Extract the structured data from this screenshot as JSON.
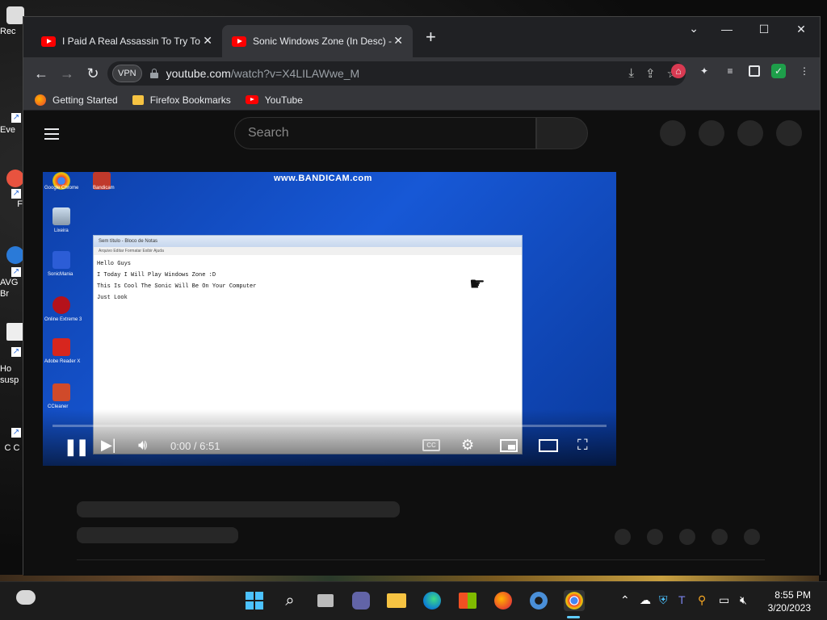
{
  "desktop": {
    "icons": [
      {
        "label": "Rec"
      },
      {
        "label": "Eve"
      },
      {
        "label": "F"
      },
      {
        "label": "AVG Br"
      },
      {
        "label": "Ho susp"
      },
      {
        "label": "C C"
      }
    ]
  },
  "browser": {
    "tabs": [
      {
        "title": "I Paid A Real Assassin To Try To Ki",
        "active": false,
        "icon": "youtube-icon"
      },
      {
        "title": "Sonic Windows Zone (In Desc) - Y",
        "active": true,
        "icon": "youtube-icon"
      }
    ],
    "new_tab_label": "+",
    "url_host": "youtube.com",
    "url_path": "/watch?v=X4LILAWwe_M",
    "vpn_label": "VPN",
    "bookmarks": [
      {
        "label": "Getting Started",
        "icon": "firefox-icon"
      },
      {
        "label": "Firefox Bookmarks",
        "icon": "folder-icon"
      },
      {
        "label": "YouTube",
        "icon": "youtube-icon"
      }
    ]
  },
  "youtube": {
    "search_placeholder": "Search",
    "player": {
      "watermark": "www.BANDICAM.com",
      "time": "0:00 / 6:51",
      "cc_label": "CC",
      "progress_fraction": 0.0,
      "inner_icons": [
        {
          "label": "Google Chrome"
        },
        {
          "label": "Bandicam"
        },
        {
          "label": "Lixeira"
        },
        {
          "label": "SonicMania"
        },
        {
          "label": "Online Extreme 3"
        },
        {
          "label": "Adobe Reader X"
        },
        {
          "label": "CCleaner"
        }
      ],
      "notepad": {
        "title": "Sem título - Bloco de Notas",
        "menu": "Arquivo   Editar   Formatar   Exibir   Ajuda",
        "lines": [
          "Hello Guys",
          "I Today I Will Play Windows Zone :D",
          "This Is Cool The Sonic Will Be On Your Computer",
          "Just Look"
        ]
      }
    }
  },
  "taskbar": {
    "time": "8:55 PM",
    "date": "3/20/2023"
  },
  "colors": {
    "accent": "#ff0000",
    "player_blue": "#1758d6",
    "taskbar_active": "#60cdff"
  }
}
